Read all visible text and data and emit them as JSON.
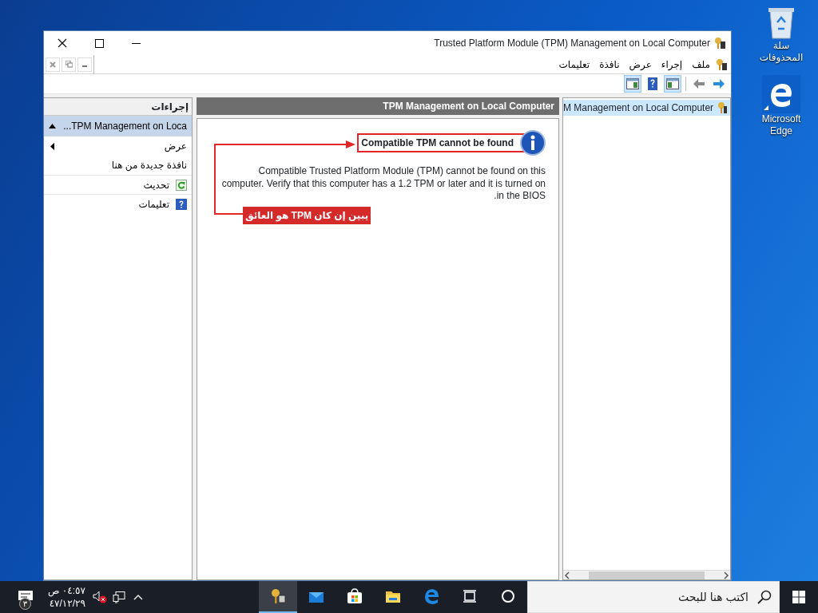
{
  "window": {
    "title": "Trusted Platform Module (TPM) Management on Local Computer"
  },
  "menu": [
    "ملف",
    "إجراء",
    "عرض",
    "نافذة",
    "تعليمات"
  ],
  "toolbar": [
    {
      "kind": "forward",
      "disabled": false
    },
    {
      "kind": "back",
      "disabled": true
    },
    {
      "kind": "separator"
    },
    {
      "kind": "console-tree",
      "pressed": true
    },
    {
      "kind": "help",
      "pressed": false
    },
    {
      "kind": "action-pane",
      "pressed": true
    }
  ],
  "tree": {
    "items": [
      {
        "label": "M Management on Local Computer",
        "selected": true
      }
    ]
  },
  "main": {
    "header": "TPM Management on Local Computer",
    "status_title": "Compatible TPM cannot be found",
    "status_text": "Compatible Trusted Platform Module (TPM) cannot be found on this computer. Verify that this computer has a 1.2 TPM or later and it is turned on in the BIOS.",
    "annotation": {
      "label": "يبين إن كان TPM هو العائق"
    }
  },
  "actions": {
    "title": "إجراءات",
    "group": {
      "label": "TPM Management on Loca...",
      "expanded": true
    },
    "items": [
      {
        "label": "عرض",
        "kind": "submenu"
      },
      {
        "label": "نافذة جديدة من هنا",
        "kind": "plain"
      },
      {
        "label": "تحديث",
        "kind": "refresh"
      },
      {
        "label": "تعليمات",
        "kind": "help"
      }
    ]
  },
  "desktop_icons": [
    {
      "label": "سلة المحذوفات",
      "kind": "recycle-bin"
    },
    {
      "label": "Microsoft Edge",
      "kind": "edge"
    }
  ],
  "taskbar": {
    "search": {
      "placeholder": "اكتب هنا للبحث"
    },
    "apps": [
      {
        "kind": "cortana",
        "active": false
      },
      {
        "kind": "task-view",
        "active": false
      },
      {
        "kind": "edge",
        "active": false
      },
      {
        "kind": "explorer",
        "active": false
      },
      {
        "kind": "store",
        "active": false
      },
      {
        "kind": "mail",
        "active": false
      },
      {
        "kind": "tpm",
        "active": true
      }
    ],
    "time": "٠٤:٥٧ ص",
    "date": "٤٧/١٢/٢٩",
    "volume_muted": true,
    "notification_count": "٣"
  }
}
